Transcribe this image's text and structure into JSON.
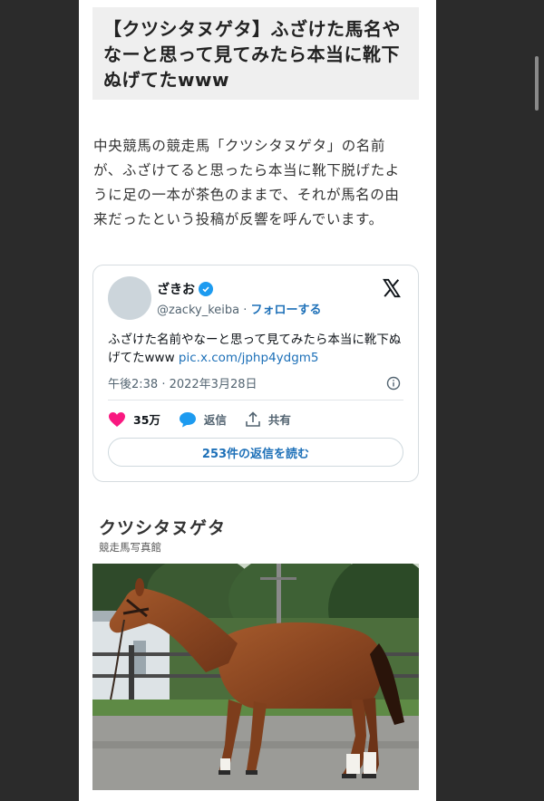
{
  "article": {
    "title": "【クツシタヌゲタ】ふざけた馬名やなーと思って見てみたら本当に靴下ぬげてたwww",
    "intro": "中央競馬の競走馬「クツシタヌゲタ」の名前が、ふざけてると思ったら本当に靴下脱げたように足の一本が茶色のままで、それが馬名の由来だったという投稿が反響を呼んでいます。"
  },
  "tweet": {
    "display_name": "ざきお",
    "handle": "@zacky_keiba",
    "separator": " · ",
    "follow_label": "フォローする",
    "text": "ふざけた名前やなーと思って見てみたら本当に靴下ぬげてたwww ",
    "link": "pic.x.com/jphp4ydgm5",
    "timestamp": "午後2:38 · 2022年3月28日",
    "likes": "35万",
    "reply_label": "返信",
    "share_label": "共有",
    "read_replies_label": "253件の返信を読む"
  },
  "photo_caption": {
    "horse_name": "クツシタヌゲタ",
    "source": "競走馬写真館"
  },
  "colors": {
    "accent_blue": "#1d9bf0",
    "link_blue": "#1d70b8",
    "like_pink": "#f91880"
  }
}
